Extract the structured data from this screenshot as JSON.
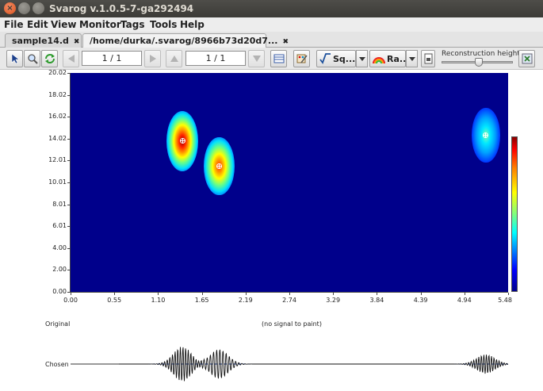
{
  "window": {
    "title": "Svarog v.1.0.5-7-ga292494"
  },
  "menu": [
    "File",
    "Edit",
    "View",
    "Monitor",
    "Tags",
    "Tools",
    "Help"
  ],
  "tabs": [
    {
      "label": "sample14.d",
      "active": false
    },
    {
      "label": "/home/durka/.svarog/8966b73d20d7...",
      "active": true
    }
  ],
  "toolbar": {
    "page_left": "1 / 1",
    "page_right": "1 / 1",
    "scale_label": "Sq...",
    "palette_label": "Ra...",
    "reconstruction_label": "Reconstruction height",
    "reconstruction_level_fraction": 0.52
  },
  "plot": {
    "y_ticks": [
      "20.02",
      "18.02",
      "16.02",
      "14.02",
      "12.01",
      "10.01",
      "8.01",
      "6.01",
      "4.00",
      "2.00",
      "0.00"
    ],
    "x_ticks": [
      "0.00",
      "0.55",
      "1.10",
      "1.65",
      "2.19",
      "2.74",
      "3.29",
      "3.84",
      "4.39",
      "4.94",
      "5.48"
    ],
    "x_range": [
      0,
      5.48
    ],
    "y_range": [
      0,
      20.02
    ],
    "atoms": [
      {
        "x": 1.4,
        "y": 13.8,
        "intensity": 1.0
      },
      {
        "x": 1.86,
        "y": 11.5,
        "intensity": 0.85
      },
      {
        "x": 5.2,
        "y": 14.3,
        "intensity": 0.55
      }
    ],
    "colors": {
      "background": "#00008b"
    }
  },
  "signals": {
    "original_label": "Original",
    "no_signal": "(no signal to paint)",
    "chosen_label": "Chosen"
  }
}
